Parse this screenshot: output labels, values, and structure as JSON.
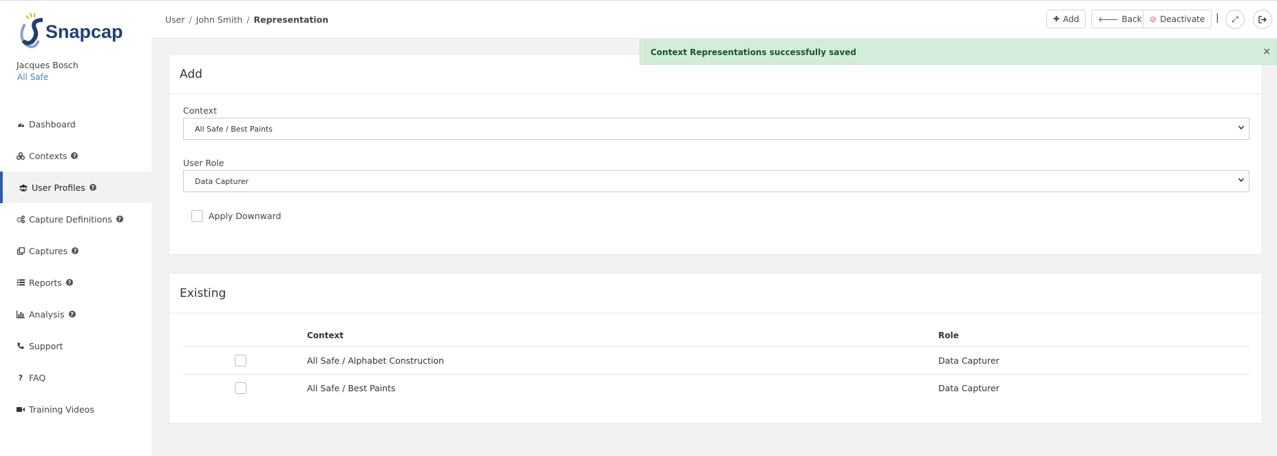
{
  "app": {
    "logo_text": "Snapcap"
  },
  "user": {
    "name": "Jacques Bosch",
    "org": "All Safe"
  },
  "sidebar": {
    "items": [
      {
        "label": "Dashboard",
        "icon": "dashboard-icon",
        "help": false,
        "active": false
      },
      {
        "label": "Contexts",
        "icon": "contexts-icon",
        "help": true,
        "active": false
      },
      {
        "label": "User Profiles",
        "icon": "users-icon",
        "help": true,
        "active": true
      },
      {
        "label": "Capture Definitions",
        "icon": "cogs-icon",
        "help": true,
        "active": false
      },
      {
        "label": "Captures",
        "icon": "captures-icon",
        "help": true,
        "active": false
      },
      {
        "label": "Reports",
        "icon": "list-icon",
        "help": true,
        "active": false
      },
      {
        "label": "Analysis",
        "icon": "bar-chart-icon",
        "help": true,
        "active": false
      },
      {
        "label": "Support",
        "icon": "phone-icon",
        "help": false,
        "active": false
      },
      {
        "label": "FAQ",
        "icon": "question-icon",
        "help": false,
        "active": false
      },
      {
        "label": "Training Videos",
        "icon": "video-icon",
        "help": false,
        "active": false
      }
    ],
    "help_glyph": "?"
  },
  "breadcrumb": {
    "items": [
      "User",
      "John Smith"
    ],
    "current": "Representation",
    "separator": "/"
  },
  "toolbar": {
    "add_label": "Add",
    "back_label": "Back",
    "deactivate_label": "Deactivate",
    "pipe": "|"
  },
  "alert": {
    "message": "Context Representations successfully saved",
    "close": "×"
  },
  "add_panel": {
    "title": "Add",
    "context_label": "Context",
    "context_value": "All Safe / Best Paints",
    "role_label": "User Role",
    "role_value": "Data Capturer",
    "apply_downward_label": "Apply Downward"
  },
  "existing_panel": {
    "title": "Existing",
    "columns": [
      "Context",
      "Role"
    ],
    "rows": [
      {
        "context": "All Safe / Alphabet Construction",
        "role": "Data Capturer"
      },
      {
        "context": "All Safe / Best Paints",
        "role": "Data Capturer"
      }
    ]
  },
  "colors": {
    "accent": "#2b5fa8",
    "alert_bg": "#d4edda",
    "alert_text": "#155724",
    "danger": "#d9534f"
  }
}
